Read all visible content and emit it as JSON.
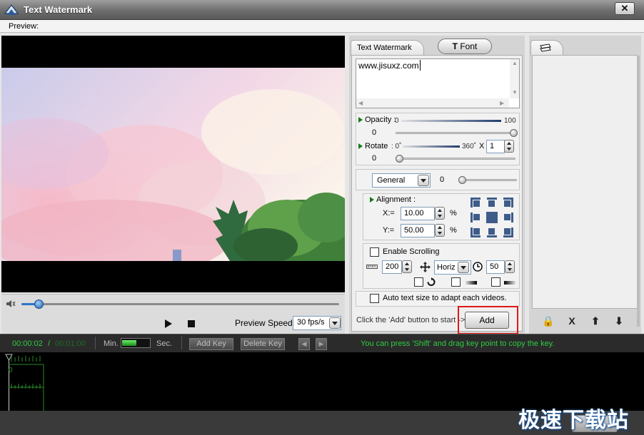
{
  "window": {
    "title": "Text Watermark",
    "close_label": "✕"
  },
  "preview": {
    "label": "Preview:",
    "speed_label": "Preview Speed:",
    "speed_value": "30 fps/s",
    "seek_progress": 0.055
  },
  "settings": {
    "tabs": {
      "text_watermark": "Text Watermark",
      "font": "Font",
      "font_icon": "T"
    },
    "text_value": "www.jisuxz.com",
    "opacity": {
      "label": "Opacity :",
      "min": "0",
      "max": "100",
      "value": "0"
    },
    "rotate": {
      "label": "Rotate",
      "min": ": 0˚",
      "max": "360˚",
      "times_label": "X",
      "count": "1",
      "value": "0"
    },
    "mode": {
      "value": "General",
      "amount": "0"
    },
    "alignment": {
      "label": "Alignment :",
      "x_label": "X:=",
      "x_value": "10.00",
      "y_label": "Y:=",
      "y_value": "50.00",
      "unit": "%"
    },
    "scrolling": {
      "label": "Enable Scrolling",
      "speed": "200",
      "direction": "Horiz",
      "duration": "50"
    },
    "auto_size_label": "Auto text size to adapt each videos.",
    "add_hint": "Click the 'Add' button to start ->",
    "add_label": "Add"
  },
  "list_panel": {
    "buttons": {
      "lock": "🔒",
      "delete": "X",
      "up": "⬆",
      "down": "⬇"
    }
  },
  "timeline": {
    "current_time": "00:00:02",
    "separator": "/",
    "total_time": "00:01:00",
    "min_label": "Min.",
    "sec_label": "Sec.",
    "add_key": "Add Key",
    "delete_key": "Delete Key",
    "hint": "You can press 'Shift' and drag key point to copy the key.",
    "marker": "0"
  },
  "footer": {
    "ok_label": "Ok",
    "watermark_text": "极速下载站"
  },
  "colors": {
    "accent_green": "#2ecc40",
    "highlight_red": "#e01818",
    "seek_blue": "#2f76c5"
  }
}
